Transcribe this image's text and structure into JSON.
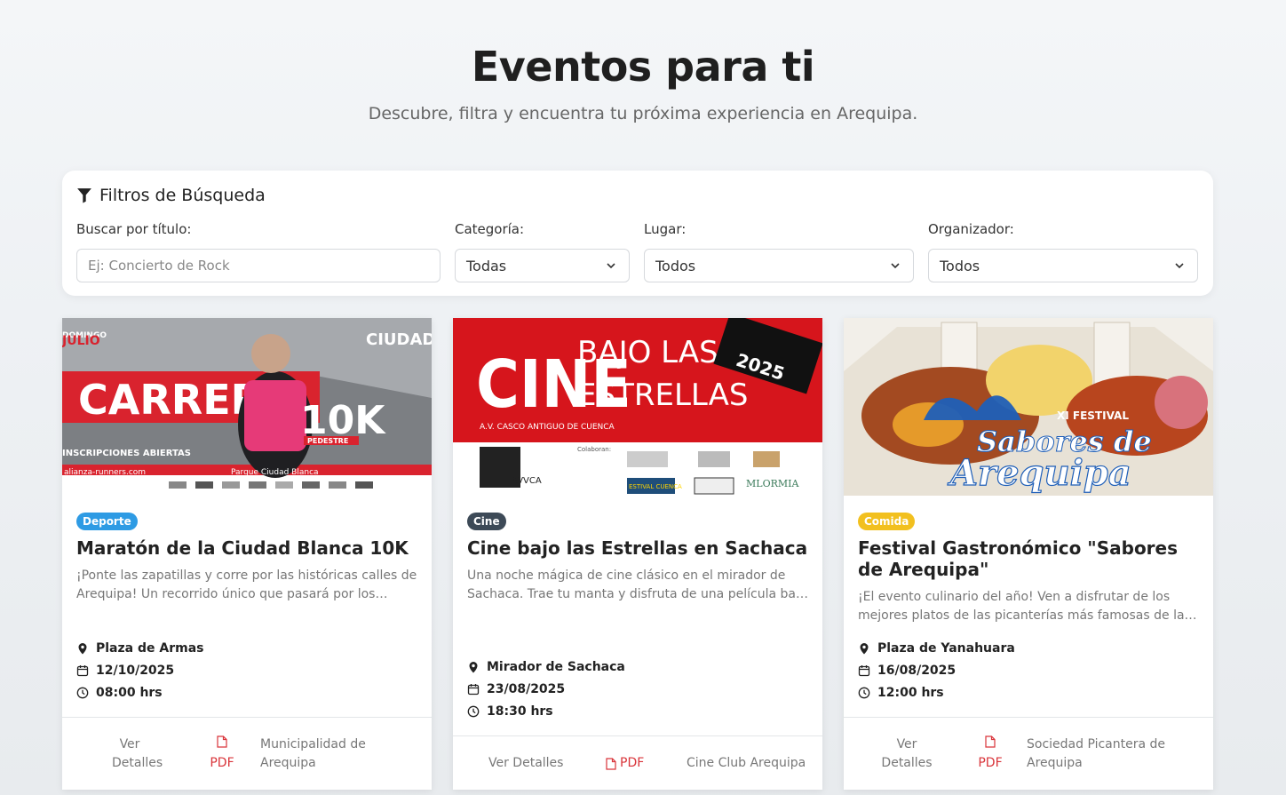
{
  "header": {
    "title": "Eventos para ti",
    "subtitle": "Descubre, filtra y encuentra tu próxima experiencia en Arequipa."
  },
  "filters": {
    "title": "Filtros de Búsqueda",
    "search_label": "Buscar por título:",
    "search_placeholder": "Ej: Concierto de Rock",
    "category_label": "Categoría:",
    "category_value": "Todas",
    "place_label": "Lugar:",
    "place_value": "Todos",
    "organizer_label": "Organizador:",
    "organizer_value": "Todos"
  },
  "events": [
    {
      "badge": "Deporte",
      "badge_color": "#2e9be4",
      "title": "Maratón de la Ciudad Blanca 10K",
      "description": "¡Ponte las zapatillas y corre por las históricas calles de Arequipa! Un recorrido único que pasará por los lugares más emblemáticos de la ciudad.",
      "place": "Plaza de Armas",
      "date": "12/10/2025",
      "time": "08:00 hrs",
      "details_label": "Ver Detalles",
      "pdf_label": "PDF",
      "organizer": "Municipalidad de Arequipa",
      "image": {
        "text_carrera": "CARRERA",
        "text_10k": "10K",
        "text_pedestre": "PEDESTRE",
        "text_domingo": "DOMINGO",
        "text_julio": "JULIO",
        "text_ciudad": "CIUDAD",
        "text_inscripciones": "INSCRIPCIONES ABIERTAS",
        "text_web": "alianza-runners.com",
        "text_parque": "Parque Ciudad Blanca"
      }
    },
    {
      "badge": "Cine",
      "badge_color": "#3d4a57",
      "title": "Cine bajo las Estrellas en Sachaca",
      "description": "Una noche mágica de cine clásico en el mirador de Sachaca. Trae tu manta y disfruta de una película bajo el cielo estrellado.",
      "place": "Mirador de Sachaca",
      "date": "23/08/2025",
      "time": "18:30 hrs",
      "details_label": "Ver Detalles",
      "pdf_label": "PDF",
      "organizer": "Cine Club Arequipa",
      "image": {
        "text_cine": "CINE",
        "text_bajo": "BAJO LAS",
        "text_estrellas": "ESTRELLAS",
        "text_year": "2025",
        "text_address": "A.V. CASCO ANTIGUO DE CUENCA",
        "text_colaboran": "Colaboran:",
        "text_avvca": "AVVCA",
        "text_festival": "ESTIVAL CUENCA",
        "text_mlormia": "MLORMIA"
      }
    },
    {
      "badge": "Comida",
      "badge_color": "#f2c01f",
      "title": "Festival Gastronómico \"Sabores de Arequipa\"",
      "description": "¡El evento culinario del año! Ven a disfrutar de los mejores platos de las picanterías más famosas de la región.",
      "place": "Plaza de Yanahuara",
      "date": "16/08/2025",
      "time": "12:00 hrs",
      "details_label": "Ver Detalles",
      "pdf_label": "PDF",
      "organizer": "Sociedad Picantera de Arequipa",
      "image": {
        "text_xi": "XI FESTIVAL",
        "text_sabores": "Sabores de",
        "text_arequipa": "Arequipa"
      }
    }
  ]
}
